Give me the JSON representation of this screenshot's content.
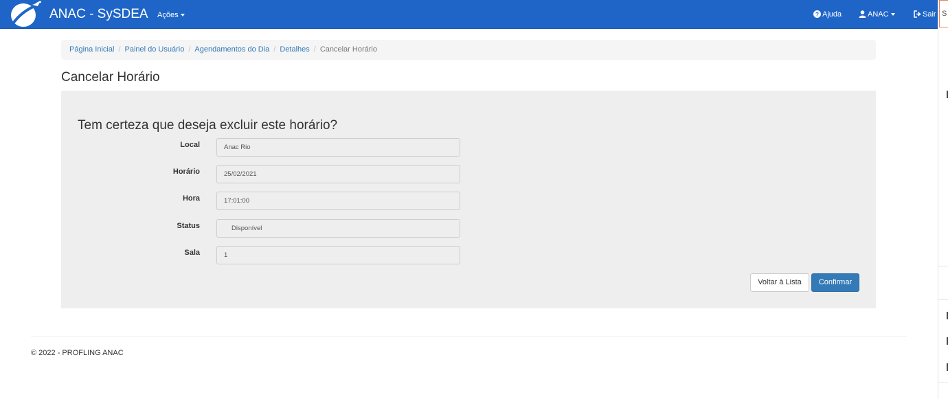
{
  "navbar": {
    "brand": "ANAC - SySDEA",
    "actions_menu": "Ações",
    "help": "Ajuda",
    "user": "ANAC",
    "logout": "Sair",
    "color": "#1e65c7",
    "icons": [
      "plane-logo-icon",
      "question-circle-icon",
      "user-icon",
      "sign-out-icon"
    ]
  },
  "side_panel": {
    "top_char": "S"
  },
  "breadcrumb": {
    "items": [
      "Página Inicial",
      "Painel do Usuário",
      "Agendamentos do Dia",
      "Detalhes"
    ],
    "active": "Cancelar Horário"
  },
  "page": {
    "title": "Cancelar Horário",
    "question": "Tem certeza que deseja excluir este horário?"
  },
  "form": {
    "fields": [
      {
        "label": "Local",
        "value": "Anac Rio"
      },
      {
        "label": "Horário",
        "value": "25/02/2021"
      },
      {
        "label": "Hora",
        "value": "17:01:00"
      },
      {
        "label": "Status",
        "value": "Disponível"
      },
      {
        "label": "Sala",
        "value": "1"
      }
    ]
  },
  "buttons": {
    "back": "Voltar à Lista",
    "confirm": "Confirmar"
  },
  "footer": {
    "text": "© 2022 - PROFLING ANAC"
  }
}
